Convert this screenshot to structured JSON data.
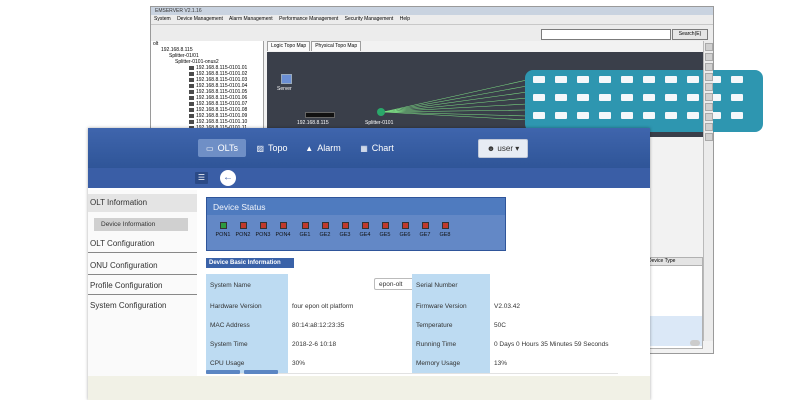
{
  "back_window": {
    "title": "EMSERVER V2.1.16",
    "menu": [
      "System",
      "Device Management",
      "Alarm Management",
      "Performance Management",
      "Security Management",
      "Help"
    ],
    "search_button": "Search(E)",
    "tree": [
      "olt",
      "192.168.8.115",
      "Splitter-01/01",
      "Splitter-0101-onus2",
      "192.168.8.115-0101.01",
      "192.168.8.115-0101.02",
      "192.168.8.115-0101.03",
      "192.168.8.115-0101.04",
      "192.168.8.115-0101.05",
      "192.168.8.115-0101.06",
      "192.168.8.115-0101.07",
      "192.168.8.115-0101.08",
      "192.168.8.115-0101.09",
      "192.168.8.115-0101.10",
      "192.168.8.115-0101.11"
    ],
    "tabs": [
      "Logic Topo Map",
      "Physical Topo Map"
    ],
    "topo": {
      "server_label": "Server",
      "olt_label": "192.168.8.115",
      "splitter_label": "Splitter-0101"
    },
    "lower_panel_header": "Device Type"
  },
  "nav": {
    "tabs": [
      {
        "label": "OLTs",
        "icon": "monitor-icon",
        "active": true
      },
      {
        "label": "Topo",
        "icon": "topology-icon"
      },
      {
        "label": "Alarm",
        "icon": "warning-icon"
      },
      {
        "label": "Chart",
        "icon": "bar-chart-icon"
      }
    ],
    "user_label": "user"
  },
  "sidebar": {
    "olt_information": "OLT Information",
    "device_information": "Device Information",
    "olt_configuration": "OLT Configuration",
    "onu_configuration": "ONU Configuration",
    "profile_configuration": "Profile Configuration",
    "system_configuration": "System Configuration"
  },
  "device_status": {
    "title": "Device Status",
    "ports": [
      {
        "label": "PON1",
        "state": "up"
      },
      {
        "label": "PON2",
        "state": "down"
      },
      {
        "label": "PON3",
        "state": "down"
      },
      {
        "label": "PON4",
        "state": "down"
      },
      {
        "label": "GE1",
        "state": "down"
      },
      {
        "label": "GE2",
        "state": "down"
      },
      {
        "label": "GE3",
        "state": "down"
      },
      {
        "label": "GE4",
        "state": "down"
      },
      {
        "label": "GE5",
        "state": "down"
      },
      {
        "label": "GE6",
        "state": "down"
      },
      {
        "label": "GE7",
        "state": "down"
      },
      {
        "label": "GE8",
        "state": "down"
      }
    ]
  },
  "basic_info": {
    "title": "Device Basic Information",
    "rows": [
      {
        "k1": "System Name",
        "v1": "epon-olt",
        "k2": "Serial Number",
        "v2": ""
      },
      {
        "k1": "Hardware Version",
        "v1": "four epon olt platform",
        "k2": "Firmware Version",
        "v2": "V2.03.42"
      },
      {
        "k1": "MAC Address",
        "v1": "80:14:a8:12:23:35",
        "k2": "Temperature",
        "v2": "50C"
      },
      {
        "k1": "System Time",
        "v1": "2018-2-6 10:18",
        "k2": "Running Time",
        "v2": "0 Days 0 Hours 35 Minutes 59 Seconds"
      },
      {
        "k1": "CPU Usage",
        "v1": "30%",
        "k2": "Memory Usage",
        "v2": "13%"
      }
    ]
  }
}
